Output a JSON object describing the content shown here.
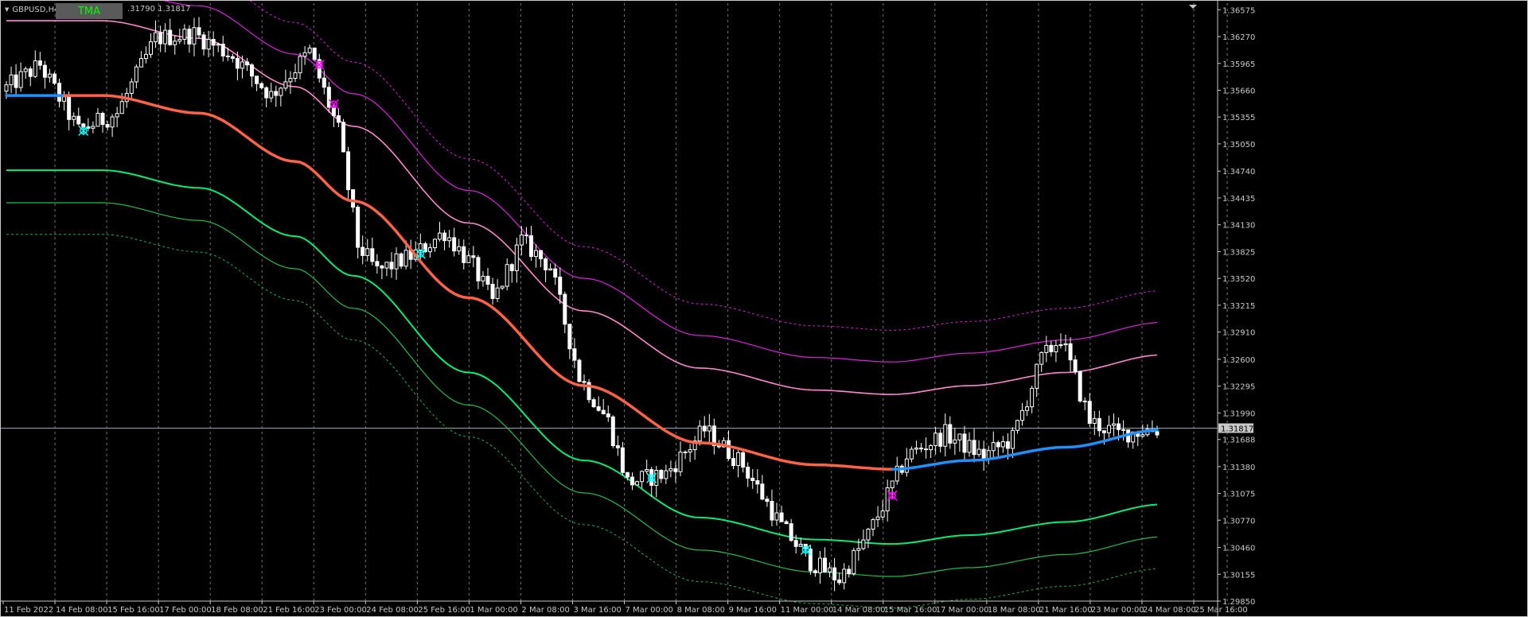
{
  "window": {
    "symbol": "GBPUSD,H4",
    "timeframe_prefix": "1",
    "ohlc_text": ".31790 1.31817",
    "indicator_button": "TMA"
  },
  "colors": {
    "background": "#000000",
    "grid": "#808080",
    "axis_text": "#c8c8c8",
    "candle_bull": "#ffffff",
    "candle_bear": "#ffffff",
    "tma_down": "#ff6347",
    "tma_up": "#1e90ff",
    "upper_band_inner": "#ff88cc",
    "upper_band_mid": "#dd22dd",
    "upper_band_outer": "#cc22cc",
    "lower_band_inner": "#00ee77",
    "lower_band_mid": "#22bb55",
    "lower_band_outer": "#22aa55",
    "bid_line": "#8ea6b6",
    "arrow_buy": "#00ffff",
    "arrow_sell": "#ff00ff"
  },
  "chart_data": {
    "type": "candlestick",
    "title": "GBPUSD,H4",
    "ylim": [
      1.2985,
      1.3665
    ],
    "current_price": 1.31817,
    "current_price_label": "1.31817",
    "y_ticks": [
      "1.36575",
      "1.36270",
      "1.35965",
      "1.35660",
      "1.35355",
      "1.35050",
      "1.34740",
      "1.34435",
      "1.34130",
      "1.33825",
      "1.33520",
      "1.33215",
      "1.32910",
      "1.32600",
      "1.32295",
      "1.31990",
      "1.31688",
      "1.31380",
      "1.31075",
      "1.30770",
      "1.30460",
      "1.30155",
      "1.29850"
    ],
    "x_labels": [
      "11 Feb 2022",
      "14 Feb 08:00",
      "15 Feb 16:00",
      "17 Feb 00:00",
      "18 Feb 08:00",
      "21 Feb 16:00",
      "23 Feb 00:00",
      "24 Feb 08:00",
      "25 Feb 16:00",
      "1 Mar 00:00",
      "2 Mar 08:00",
      "3 Mar 16:00",
      "7 Mar 00:00",
      "8 Mar 08:00",
      "9 Mar 16:00",
      "11 Mar 00:00",
      "14 Mar 08:00",
      "15 Mar 16:00",
      "17 Mar 00:00",
      "18 Mar 08:00",
      "21 Mar 16:00",
      "23 Mar 00:00",
      "24 Mar 08:00",
      "25 Mar 16:00"
    ],
    "bar_count": 240,
    "price_path": [
      [
        0,
        1.3565
      ],
      [
        8,
        1.3595
      ],
      [
        16,
        1.352
      ],
      [
        24,
        1.354
      ],
      [
        32,
        1.3625
      ],
      [
        40,
        1.363
      ],
      [
        48,
        1.3605
      ],
      [
        56,
        1.356
      ],
      [
        64,
        1.361
      ],
      [
        70,
        1.352
      ],
      [
        74,
        1.339
      ],
      [
        78,
        1.336
      ],
      [
        86,
        1.338
      ],
      [
        92,
        1.3405
      ],
      [
        98,
        1.3365
      ],
      [
        102,
        1.3325
      ],
      [
        108,
        1.3395
      ],
      [
        114,
        1.3365
      ],
      [
        120,
        1.324
      ],
      [
        126,
        1.319
      ],
      [
        130,
        1.312
      ],
      [
        138,
        1.313
      ],
      [
        146,
        1.318
      ],
      [
        154,
        1.314
      ],
      [
        162,
        1.307
      ],
      [
        168,
        1.303
      ],
      [
        174,
        1.301
      ],
      [
        180,
        1.306
      ],
      [
        188,
        1.315
      ],
      [
        196,
        1.3175
      ],
      [
        204,
        1.315
      ],
      [
        210,
        1.317
      ],
      [
        216,
        1.326
      ],
      [
        220,
        1.3285
      ],
      [
        226,
        1.319
      ],
      [
        232,
        1.3175
      ],
      [
        238,
        1.318
      ]
    ],
    "tma_path": [
      [
        0,
        1.356
      ],
      [
        20,
        1.356
      ],
      [
        40,
        1.354
      ],
      [
        60,
        1.3485
      ],
      [
        72,
        1.344
      ],
      [
        96,
        1.333
      ],
      [
        120,
        1.323
      ],
      [
        144,
        1.3165
      ],
      [
        168,
        1.314
      ],
      [
        184,
        1.3135
      ],
      [
        200,
        1.3145
      ],
      [
        220,
        1.316
      ],
      [
        240,
        1.318
      ]
    ],
    "tma_turn_index": 184,
    "band_offsets": {
      "upper_inner": 0.0085,
      "upper_mid": 0.0122,
      "upper_outer": 0.0158,
      "lower_inner": -0.0085,
      "lower_mid": -0.0122,
      "lower_outer": -0.0158
    },
    "signals": [
      {
        "index": 16,
        "type": "buy"
      },
      {
        "index": 65,
        "type": "sell"
      },
      {
        "index": 68,
        "type": "sell"
      },
      {
        "index": 86,
        "type": "buy"
      },
      {
        "index": 134,
        "type": "buy"
      },
      {
        "index": 166,
        "type": "buy"
      },
      {
        "index": 184,
        "type": "sell"
      }
    ]
  }
}
